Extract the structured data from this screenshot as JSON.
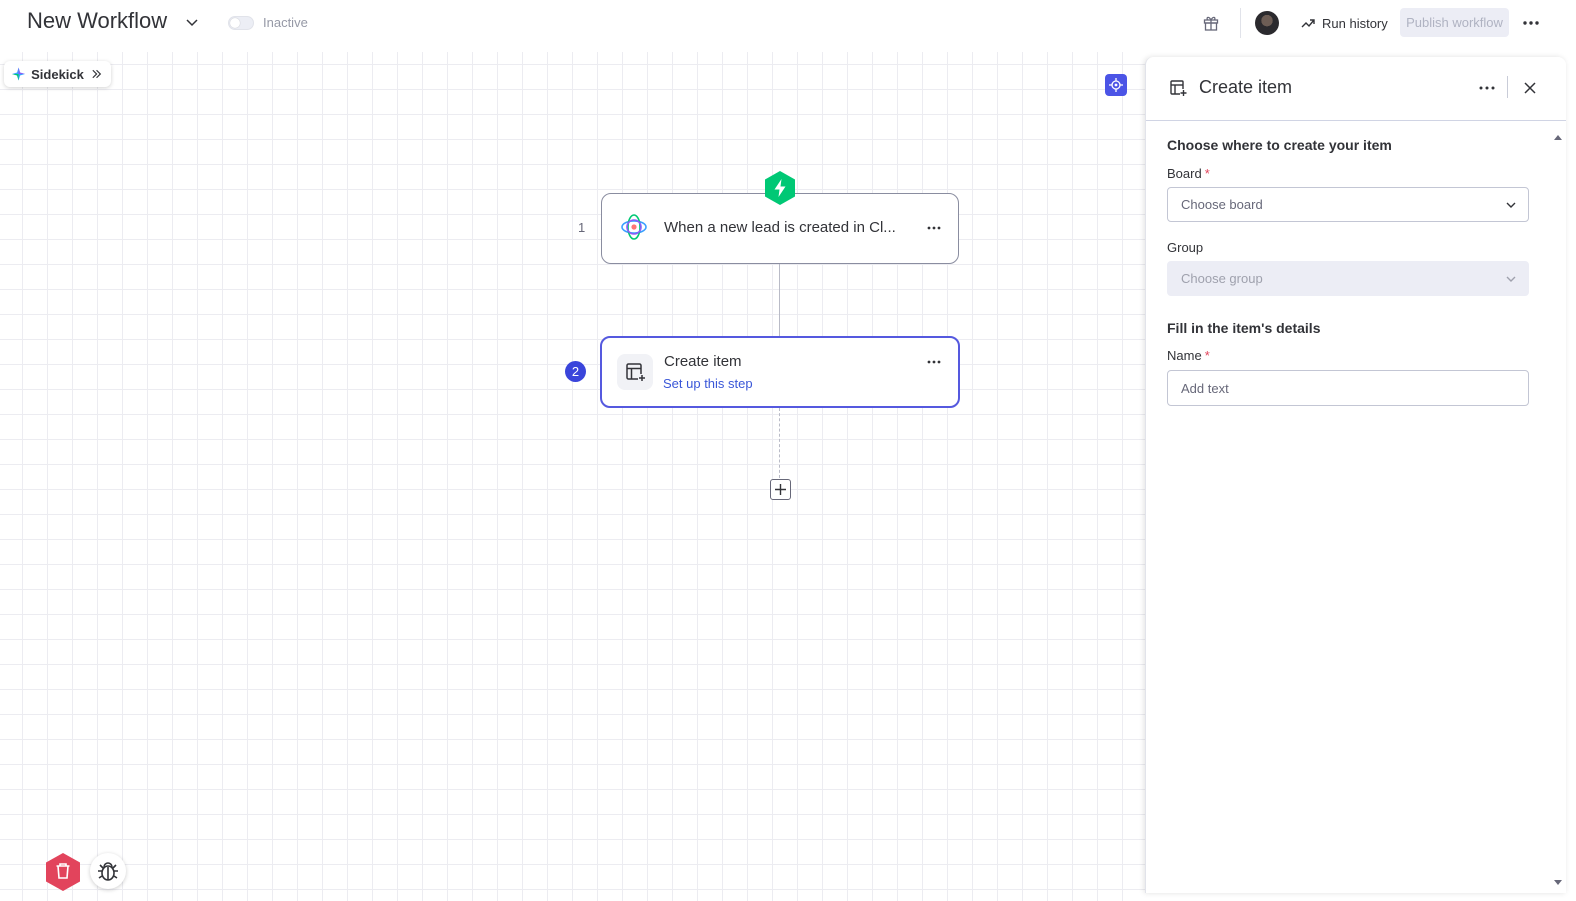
{
  "topbar": {
    "workflow_title": "New Workflow",
    "status_label": "Inactive",
    "run_history_label": "Run history",
    "publish_label": "Publish workflow"
  },
  "canvas": {
    "sidekick_label": "Sidekick",
    "steps": [
      {
        "number": "1",
        "title": "When a new lead is created in Cl...",
        "app_icon": "crm-app-icon"
      },
      {
        "number": "2",
        "title": "Create item",
        "subtitle": "Set up this step",
        "app_icon": "create-item-icon"
      }
    ]
  },
  "panel": {
    "title": "Create item",
    "section_location": "Choose where to create your item",
    "board_label": "Board",
    "board_placeholder": "Choose board",
    "group_label": "Group",
    "group_placeholder": "Choose group",
    "section_details": "Fill in the item's details",
    "name_label": "Name",
    "name_placeholder": "Add text",
    "required_mark": "*"
  },
  "colors": {
    "accent": "#5559df",
    "trigger_green": "#00c875",
    "delete_red": "#e2445c",
    "link_blue": "#3a57d8"
  }
}
